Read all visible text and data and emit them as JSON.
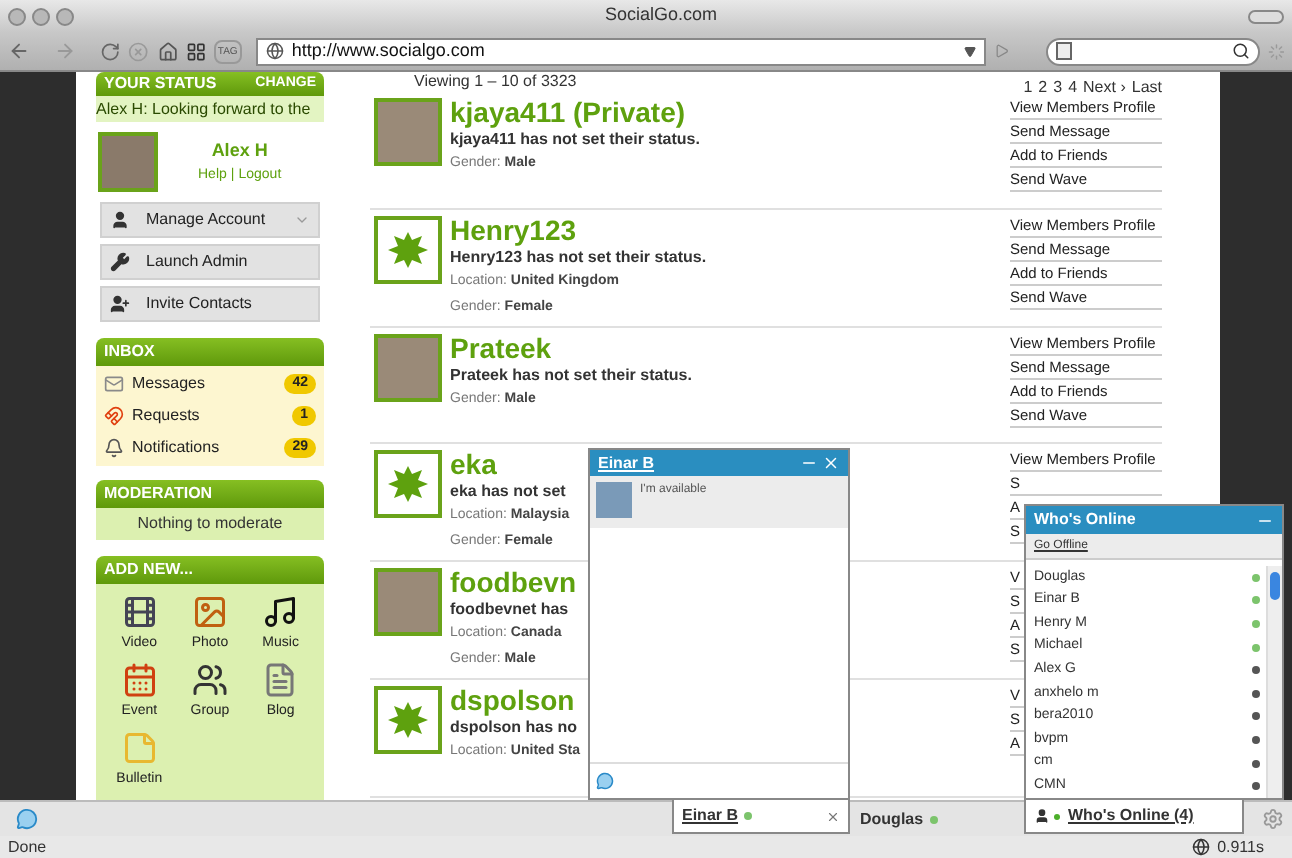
{
  "window": {
    "title": "SocialGo.com"
  },
  "toolbar": {
    "tag_label": "TAG",
    "url": "http://www.socialgo.com"
  },
  "sidebar": {
    "status": {
      "title": "YOUR STATUS",
      "action": "CHANGE",
      "text": "Alex H: Looking forward to the"
    },
    "profile": {
      "name": "Alex H",
      "links": [
        "Help",
        "Logout"
      ],
      "separator": "|"
    },
    "menu": [
      {
        "kind": "account",
        "label": "Manage Account",
        "expandable": true
      },
      {
        "kind": "admin",
        "label": "Launch Admin",
        "expandable": false
      },
      {
        "kind": "invite",
        "label": "Invite Contacts",
        "expandable": false
      }
    ],
    "inbox": {
      "title": "INBOX",
      "items": [
        {
          "kind": "messages",
          "label": "Messages",
          "count": "42"
        },
        {
          "kind": "requests",
          "label": "Requests",
          "count": "1"
        },
        {
          "kind": "notifications",
          "label": "Notifications",
          "count": "29"
        }
      ]
    },
    "moderation": {
      "title": "MODERATION",
      "text": "Nothing to moderate"
    },
    "add_new": {
      "title": "ADD NEW...",
      "items": [
        {
          "kind": "video",
          "label": "Video"
        },
        {
          "kind": "photo",
          "label": "Photo"
        },
        {
          "kind": "music",
          "label": "Music"
        },
        {
          "kind": "event",
          "label": "Event"
        },
        {
          "kind": "group",
          "label": "Group"
        },
        {
          "kind": "blog",
          "label": "Blog"
        },
        {
          "kind": "bulletin",
          "label": "Bulletin"
        }
      ]
    }
  },
  "members": {
    "viewing": "Viewing 1 – 10 of 3323",
    "pagination": [
      "1",
      "2",
      "3",
      "4",
      "Next ›",
      "Last"
    ],
    "rows": [
      {
        "kind": "photo",
        "name": "kjaya411 (Private)",
        "status": "kjaya411 has not set their status.",
        "fields": [
          {
            "label": "Gender:",
            "value": "Male"
          }
        ],
        "actions": [
          "View Members Profile",
          "Send Message",
          "Add to Friends",
          "Send Wave"
        ]
      },
      {
        "kind": "logo",
        "name": "Henry123",
        "status": "Henry123 has not set their status.",
        "fields": [
          {
            "label": "Location:",
            "value": "United Kingdom"
          },
          {
            "label": "Gender:",
            "value": "Female"
          }
        ],
        "actions": [
          "View Members Profile",
          "Send Message",
          "Add to Friends",
          "Send Wave"
        ]
      },
      {
        "kind": "photo",
        "name": "Prateek",
        "status": "Prateek has not set their status.",
        "fields": [
          {
            "label": "Gender:",
            "value": "Male"
          }
        ],
        "actions": [
          "View Members Profile",
          "Send Message",
          "Add to Friends",
          "Send Wave"
        ]
      },
      {
        "kind": "logo",
        "name": "eka",
        "status": "eka has not set",
        "fields": [
          {
            "label": "Location:",
            "value": "Malaysia"
          },
          {
            "label": "Gender:",
            "value": "Female"
          }
        ],
        "actions": [
          "View Members Profile",
          "S",
          "A",
          "S"
        ]
      },
      {
        "kind": "photo",
        "name": "foodbevn",
        "status": "foodbevnet has",
        "fields": [
          {
            "label": "Location:",
            "value": "Canada"
          },
          {
            "label": "Gender:",
            "value": "Male"
          }
        ],
        "actions": [
          "V",
          "S",
          "A",
          "S"
        ]
      },
      {
        "kind": "logo",
        "name": "dspolson",
        "status": "dspolson has no",
        "fields": [
          {
            "label": "Location:",
            "value": "United Sta"
          }
        ],
        "actions": [
          "V",
          "S",
          "A"
        ]
      }
    ]
  },
  "chat_window": {
    "title": "Einar B",
    "message": "I'm available",
    "tab": {
      "label": "Einar B",
      "color": "#7cc46c"
    }
  },
  "chat_bar": {
    "tabs": [
      {
        "label": "Douglas",
        "color": "#7cc46c"
      }
    ]
  },
  "whos_online": {
    "title": "Who's Online",
    "action": "Go Offline",
    "tab": {
      "label": "Who's Online (4)",
      "color": "#4caf2a"
    },
    "users": [
      {
        "name": "Douglas",
        "color": "#7cc46c"
      },
      {
        "name": "Einar B",
        "color": "#7cc46c"
      },
      {
        "name": "Henry M",
        "color": "#7cc46c"
      },
      {
        "name": "Michael",
        "color": "#7cc46c"
      },
      {
        "name": "Alex G",
        "color": "#555555"
      },
      {
        "name": "anxhelo m",
        "color": "#555555"
      },
      {
        "name": "bera2010",
        "color": "#555555"
      },
      {
        "name": "bvpm",
        "color": "#555555"
      },
      {
        "name": "cm",
        "color": "#555555"
      },
      {
        "name": "CMN",
        "color": "#555555"
      }
    ]
  },
  "status_bar": {
    "text": "Done",
    "timing": "0.911s"
  }
}
